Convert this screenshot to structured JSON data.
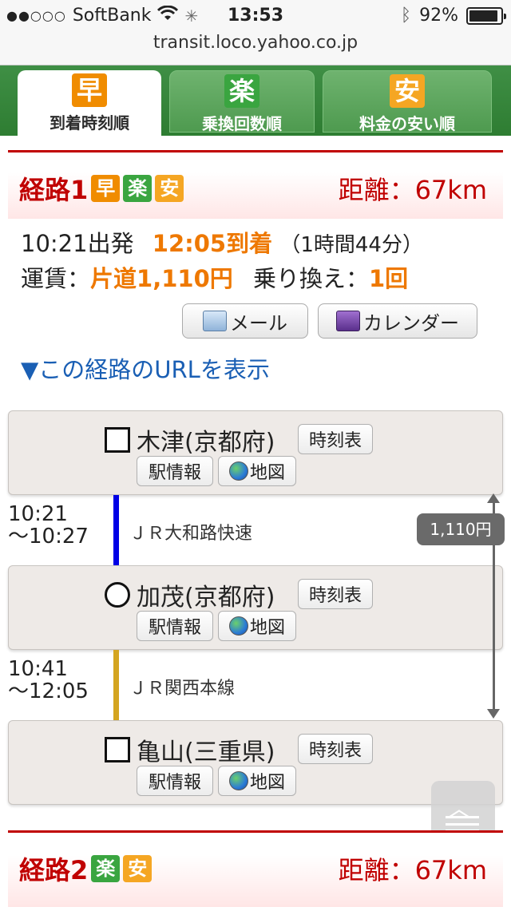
{
  "status": {
    "carrier": "SoftBank",
    "time": "13:53",
    "battery": "92%",
    "battery_fraction": 0.92
  },
  "url": "transit.loco.yahoo.co.jp",
  "tabs": [
    {
      "badge": "早",
      "label": "到着時刻順",
      "color": "#f08c00"
    },
    {
      "badge": "楽",
      "label": "乗換回数順",
      "color": "#4caf50"
    },
    {
      "badge": "安",
      "label": "料金の安い順",
      "color": "#f5a623"
    }
  ],
  "route1": {
    "title": "経路1",
    "badges": [
      "早",
      "楽",
      "安"
    ],
    "distance": "距離：67km",
    "depart": "10:21出発",
    "arrive": "12:05到着",
    "duration": "（1時間44分）",
    "fare_label": "運賃：",
    "fare_value": "片道1,110円",
    "transfer_label": "乗り換え：",
    "transfer_value": "1回",
    "mail_button": "メール",
    "calendar_button": "カレンダー",
    "url_link": "▼この経路のURLを表示"
  },
  "station_buttons": {
    "timetable": "時刻表",
    "info": "駅情報",
    "map": "地図"
  },
  "stations": [
    {
      "name": "木津(京都府)",
      "symbol": "square"
    },
    {
      "name": "加茂(京都府)",
      "symbol": "circle"
    },
    {
      "name": "亀山(三重県)",
      "symbol": "square"
    }
  ],
  "segments": [
    {
      "time_start": "10:21",
      "time_end": "～10:27",
      "line": "ＪＲ大和路快速",
      "color": "#0000e6"
    },
    {
      "time_start": "10:41",
      "time_end": "～12:05",
      "line": "ＪＲ関西本線",
      "color": "#d4a520"
    }
  ],
  "fare_total": "1,110円",
  "route2": {
    "title": "経路2",
    "badges": [
      "楽",
      "安"
    ],
    "distance": "距離：67km"
  }
}
